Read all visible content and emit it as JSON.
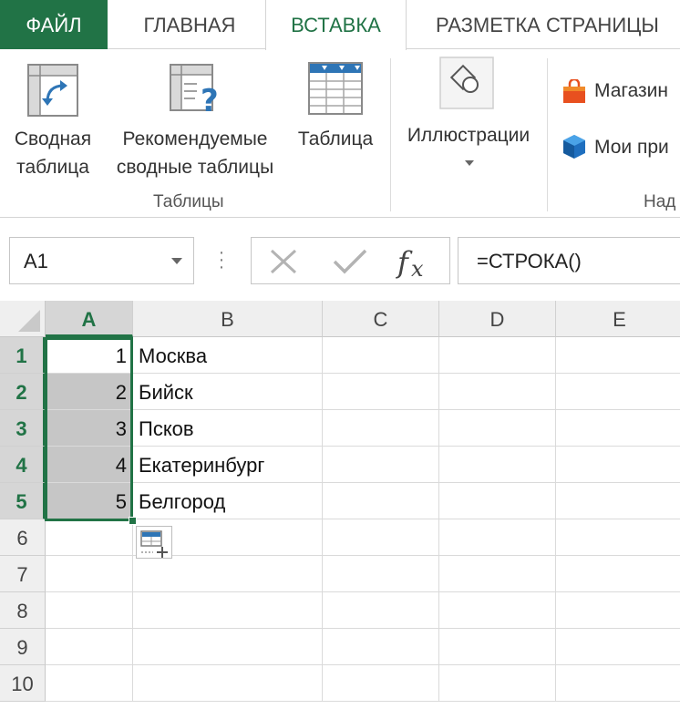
{
  "ribbon_tabs": {
    "file": "ФАЙЛ",
    "home": "ГЛАВНАЯ",
    "insert": "ВСТАВКА",
    "page_layout": "РАЗМЕТКА СТРАНИЦЫ"
  },
  "ribbon": {
    "pivot_table": {
      "line1": "Сводная",
      "line2": "таблица"
    },
    "recommended_pivot": {
      "line1": "Рекомендуемые",
      "line2": "сводные таблицы"
    },
    "table": "Таблица",
    "tables_group": "Таблицы",
    "illustrations": "Иллюстрации",
    "store": "Магазин",
    "my_apps": "Мои при",
    "addins_group": "Над"
  },
  "formula_bar": {
    "name_box": "A1",
    "formula": "=СТРОКА()"
  },
  "sheet": {
    "columns": [
      "A",
      "B",
      "C",
      "D",
      "E"
    ],
    "rows": [
      "1",
      "2",
      "3",
      "4",
      "5",
      "6",
      "7",
      "8",
      "9",
      "10"
    ],
    "col_a": [
      "1",
      "2",
      "3",
      "4",
      "5"
    ],
    "col_b": [
      "Москва",
      "Бийск",
      "Псков",
      "Екатеринбург",
      "Белгород"
    ]
  },
  "colors": {
    "accent": "#217346",
    "selection_fill": "#c6c6c6",
    "header_fill": "#efefef"
  },
  "icons": [
    "pivot-table-icon",
    "recommended-pivot-icon",
    "table-icon",
    "illustrations-icon",
    "store-icon",
    "my-apps-icon",
    "cancel-icon",
    "enter-icon",
    "fx-icon",
    "quick-analysis-icon",
    "dropdown-arrow-icon"
  ]
}
